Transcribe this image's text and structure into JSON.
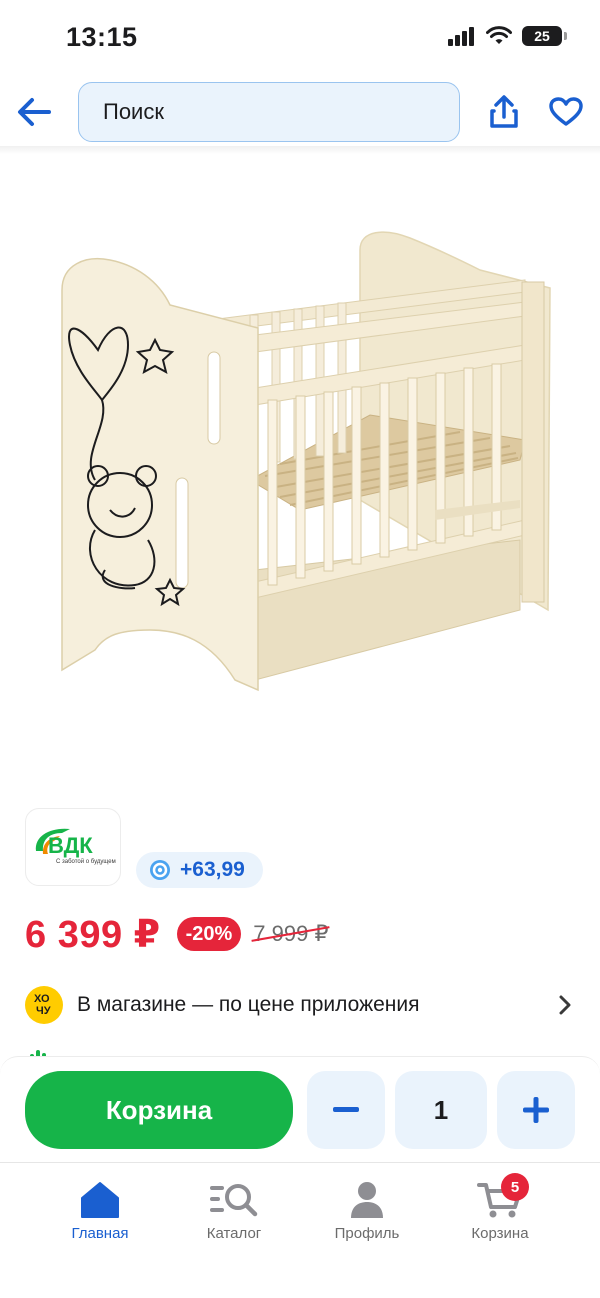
{
  "status_bar": {
    "time": "13:15",
    "battery": "25"
  },
  "header": {
    "search_placeholder": "Поиск"
  },
  "brand": {
    "logo_text": "ВДК",
    "logo_tagline": "С заботой о будущем"
  },
  "bonus": {
    "value": "+63,99"
  },
  "pricing": {
    "price": "6 399 ₽",
    "discount": "-20%",
    "old_price": "7 999 ₽"
  },
  "store": {
    "text": "В магазине — по цене приложения",
    "badge_top": "ХО",
    "badge_bottom": "ЧУ"
  },
  "action_bar": {
    "cart_label": "Корзина",
    "quantity": "1"
  },
  "bottom_nav": {
    "items": [
      {
        "label": "Главная",
        "active": true
      },
      {
        "label": "Каталог"
      },
      {
        "label": "Профиль"
      },
      {
        "label": "Корзина",
        "badge": "5"
      }
    ]
  },
  "colors": {
    "accent_blue": "#1a5fd0",
    "price_red": "#e5253a",
    "cart_green": "#16b449",
    "chip_bg": "#eaf3fc"
  }
}
